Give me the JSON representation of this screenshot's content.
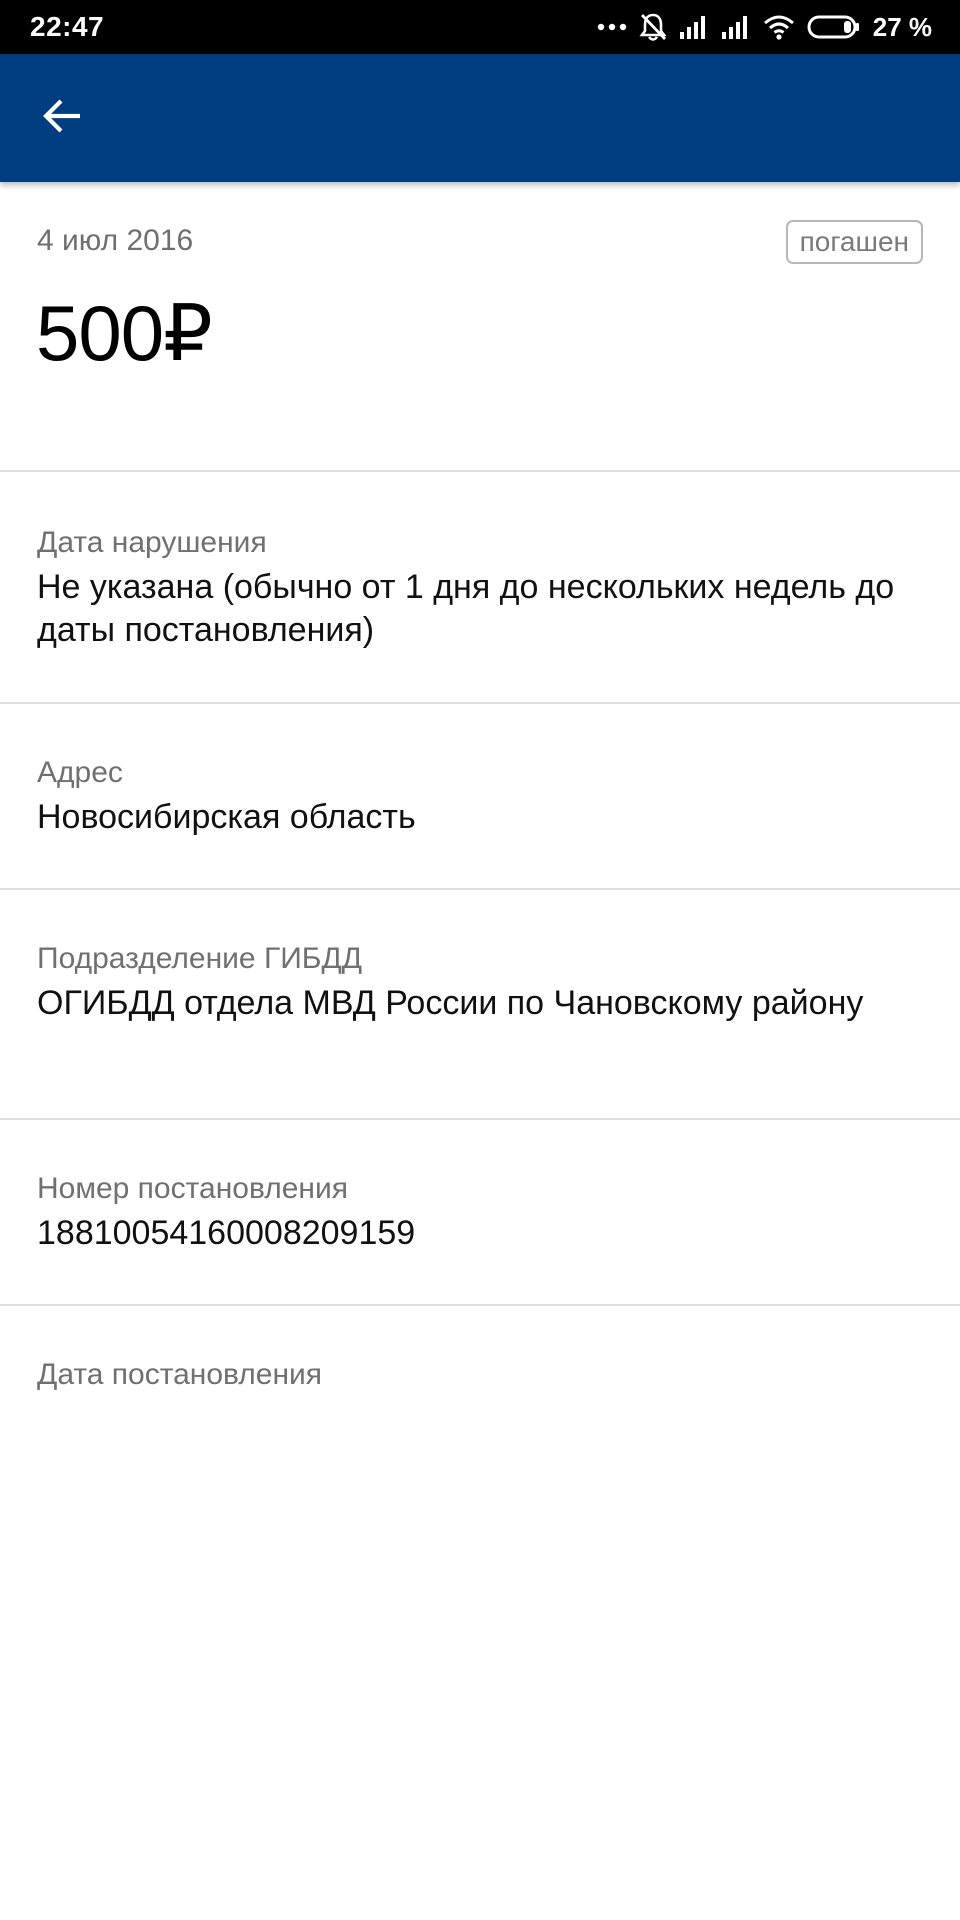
{
  "status_bar": {
    "time": "22:47",
    "battery_percent": "27 %",
    "icons": [
      "more-dots-icon",
      "notifications-off-icon",
      "signal-icon",
      "signal-icon",
      "wifi-icon",
      "battery-icon"
    ]
  },
  "app_bar": {
    "color": "#003c80",
    "back_icon": "arrow-back-icon"
  },
  "fine": {
    "date": "4 июл 2016",
    "status": "погашен",
    "amount": "500₽"
  },
  "details": [
    {
      "label": "Дата нарушения",
      "value": "Не указана (обычно от 1 дня до нескольких недель до даты постановления)"
    },
    {
      "label": "Адрес",
      "value": "Новосибирская область"
    },
    {
      "label": "Подразделение ГИБДД",
      "value": "ОГИБДД отдела МВД России по Чановскому району"
    },
    {
      "label": "Номер постановления",
      "value": "18810054160008209159"
    },
    {
      "label": "Дата постановления",
      "value": ""
    }
  ]
}
